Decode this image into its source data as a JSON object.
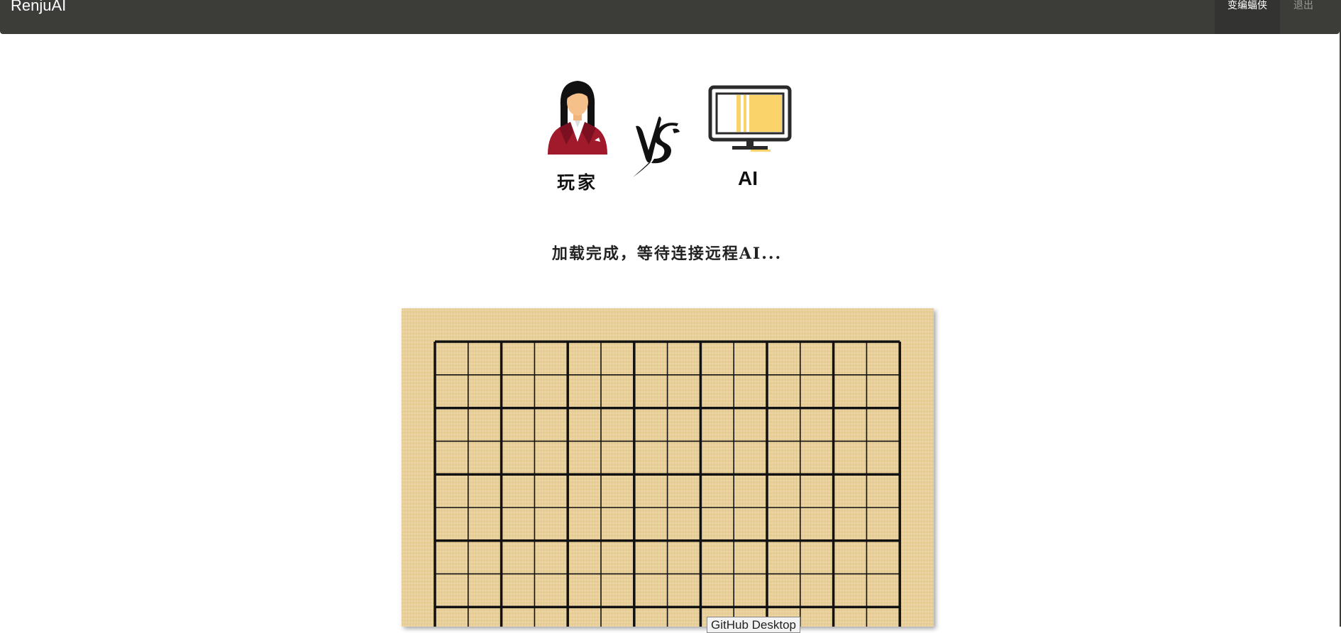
{
  "navbar": {
    "brand": "RenjuAI",
    "user": "变编蝠侠",
    "logout": "退出"
  },
  "match": {
    "player_label": "玩家",
    "ai_label": "AI",
    "status": "加载完成，等待连接远程AI..."
  },
  "board": {
    "grid_lines": 15,
    "visible_rows": 9,
    "stones": []
  },
  "tooltip": {
    "text": "GitHub Desktop"
  },
  "colors": {
    "navbar_bg": "#3c3d39",
    "board_wood": "#e8cf98",
    "grid_line": "#111111",
    "monitor_screen": "#fad46a",
    "avatar_jacket": "#a01a2c"
  }
}
